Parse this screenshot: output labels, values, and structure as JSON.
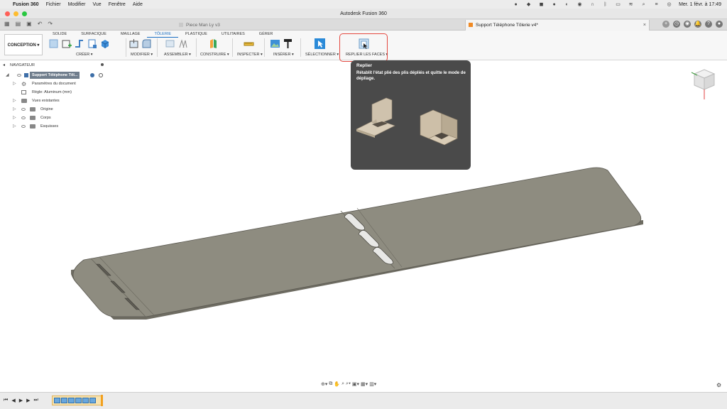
{
  "menubar": {
    "apple_glyph": "",
    "app_name": "Fusion 360",
    "items": [
      "Fichier",
      "Modifier",
      "Vue",
      "Fenêtre",
      "Aide"
    ],
    "datetime": "Mer. 1 févr. à 17:49"
  },
  "window": {
    "title": "Autodesk Fusion 360"
  },
  "tabs": {
    "tab1": "Piece Man Ly v3",
    "tab2": "Support Téléphone Tôlerie v4*"
  },
  "ribbon": {
    "workspace": "CONCEPTION ▾",
    "tabs": [
      "SOLIDE",
      "SURFACIQUE",
      "MAILLAGE",
      "TÔLERIE",
      "PLASTIQUE",
      "UTILITAIRES",
      "GÉRER"
    ],
    "active_tab": "TÔLERIE",
    "groups": {
      "creer": "CRÉER ▾",
      "modifier": "MODIFIER ▾",
      "assembler": "ASSEMBLER ▾",
      "construire": "CONSTRUIRE ▾",
      "inspecter": "INSPECTER ▾",
      "inserer": "INSÉRER ▾",
      "selectionner": "SÉLECTIONNER ▾",
      "replier": "REPLIER LES FACES ▾"
    }
  },
  "navigator": {
    "title": "NAVIGATEUR",
    "root": "Support Téléphone Tôl...",
    "items": [
      "Paramètres du document",
      "Règle: Aluminum (mm)",
      "Vues existantes",
      "Origine",
      "Corps",
      "Esquisses"
    ]
  },
  "tooltip": {
    "title": "Replier",
    "description": "Rétablit l'état plié des plis dépliés et quitte le mode de dépliage."
  },
  "colors": {
    "accent": "#1a6ec2",
    "highlight": "#e4473f",
    "plate": "#8c8a7e"
  }
}
